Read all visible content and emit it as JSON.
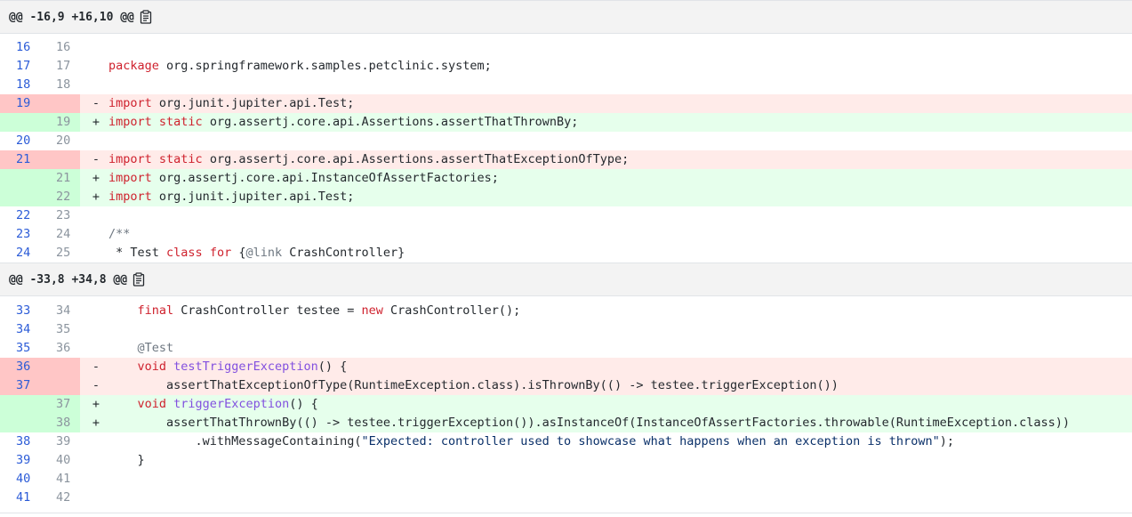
{
  "hunks": [
    {
      "header": "@@ -16,9 +16,10 @@",
      "lines": [
        {
          "type": "context",
          "old": "16",
          "new": "16",
          "sign": "",
          "tokens": []
        },
        {
          "type": "context",
          "old": "17",
          "new": "17",
          "sign": "",
          "tokens": [
            {
              "c": "kw",
              "t": "package"
            },
            {
              "c": "plain",
              "t": " org.springframework.samples.petclinic.system;"
            }
          ]
        },
        {
          "type": "context",
          "old": "18",
          "new": "18",
          "sign": "",
          "tokens": []
        },
        {
          "type": "del",
          "old": "19",
          "new": "",
          "sign": "-",
          "tokens": [
            {
              "c": "kw",
              "t": "import"
            },
            {
              "c": "plain",
              "t": " org.junit.jupiter.api.Test;"
            }
          ]
        },
        {
          "type": "add",
          "old": "",
          "new": "19",
          "sign": "+",
          "tokens": [
            {
              "c": "kw",
              "t": "import"
            },
            {
              "c": "plain",
              "t": " "
            },
            {
              "c": "kw",
              "t": "static"
            },
            {
              "c": "plain",
              "t": " org.assertj.core.api.Assertions.assertThatThrownBy;"
            }
          ]
        },
        {
          "type": "context",
          "old": "20",
          "new": "20",
          "sign": "",
          "tokens": []
        },
        {
          "type": "del",
          "old": "21",
          "new": "",
          "sign": "-",
          "tokens": [
            {
              "c": "kw",
              "t": "import"
            },
            {
              "c": "plain",
              "t": " "
            },
            {
              "c": "kw",
              "t": "static"
            },
            {
              "c": "plain",
              "t": " org.assertj.core.api.Assertions.assertThatExceptionOfType;"
            }
          ]
        },
        {
          "type": "add",
          "old": "",
          "new": "21",
          "sign": "+",
          "tokens": [
            {
              "c": "kw",
              "t": "import"
            },
            {
              "c": "plain",
              "t": " org.assertj.core.api.InstanceOfAssertFactories;"
            }
          ]
        },
        {
          "type": "add",
          "old": "",
          "new": "22",
          "sign": "+",
          "tokens": [
            {
              "c": "kw",
              "t": "import"
            },
            {
              "c": "plain",
              "t": " org.junit.jupiter.api.Test;"
            }
          ]
        },
        {
          "type": "context",
          "old": "22",
          "new": "23",
          "sign": "",
          "tokens": []
        },
        {
          "type": "context",
          "old": "23",
          "new": "24",
          "sign": "",
          "tokens": [
            {
              "c": "cm",
              "t": "/**"
            }
          ]
        },
        {
          "type": "context",
          "old": "24",
          "new": "25",
          "sign": "",
          "tokens": [
            {
              "c": "plain",
              "t": " * Test "
            },
            {
              "c": "kw",
              "t": "class"
            },
            {
              "c": "plain",
              "t": " "
            },
            {
              "c": "kw",
              "t": "for"
            },
            {
              "c": "plain",
              "t": " {"
            },
            {
              "c": "cm",
              "t": "@link"
            },
            {
              "c": "plain",
              "t": " CrashController}"
            }
          ]
        }
      ]
    },
    {
      "header": "@@ -33,8 +34,8 @@",
      "lines": [
        {
          "type": "context",
          "old": "33",
          "new": "34",
          "sign": "",
          "tokens": [
            {
              "c": "plain",
              "t": "    "
            },
            {
              "c": "kw",
              "t": "final"
            },
            {
              "c": "plain",
              "t": " CrashController testee = "
            },
            {
              "c": "kw",
              "t": "new"
            },
            {
              "c": "plain",
              "t": " CrashController();"
            }
          ]
        },
        {
          "type": "context",
          "old": "34",
          "new": "35",
          "sign": "",
          "tokens": []
        },
        {
          "type": "context",
          "old": "35",
          "new": "36",
          "sign": "",
          "tokens": [
            {
              "c": "plain",
              "t": "    "
            },
            {
              "c": "an",
              "t": "@Test"
            }
          ]
        },
        {
          "type": "del",
          "old": "36",
          "new": "",
          "sign": "-",
          "tokens": [
            {
              "c": "plain",
              "t": "    "
            },
            {
              "c": "kw",
              "t": "void"
            },
            {
              "c": "plain",
              "t": " "
            },
            {
              "c": "fn",
              "t": "testTriggerException"
            },
            {
              "c": "plain",
              "t": "() {"
            }
          ]
        },
        {
          "type": "del",
          "old": "37",
          "new": "",
          "sign": "-",
          "tokens": [
            {
              "c": "plain",
              "t": "        assertThatExceptionOfType(RuntimeException.class).isThrownBy(() -> testee.triggerException())"
            }
          ]
        },
        {
          "type": "add",
          "old": "",
          "new": "37",
          "sign": "+",
          "tokens": [
            {
              "c": "plain",
              "t": "    "
            },
            {
              "c": "kw",
              "t": "void"
            },
            {
              "c": "plain",
              "t": " "
            },
            {
              "c": "fn",
              "t": "triggerException"
            },
            {
              "c": "plain",
              "t": "() {"
            }
          ]
        },
        {
          "type": "add",
          "old": "",
          "new": "38",
          "sign": "+",
          "tokens": [
            {
              "c": "plain",
              "t": "        assertThatThrownBy(() -> testee.triggerException()).asInstanceOf(InstanceOfAssertFactories.throwable(RuntimeException.class))"
            }
          ]
        },
        {
          "type": "context",
          "old": "38",
          "new": "39",
          "sign": "",
          "tokens": [
            {
              "c": "plain",
              "t": "            .withMessageContaining("
            },
            {
              "c": "str",
              "t": "\"Expected: controller used to showcase what happens when an exception is thrown\""
            },
            {
              "c": "plain",
              "t": ");"
            }
          ]
        },
        {
          "type": "context",
          "old": "39",
          "new": "40",
          "sign": "",
          "tokens": [
            {
              "c": "plain",
              "t": "    }"
            }
          ]
        },
        {
          "type": "context",
          "old": "40",
          "new": "41",
          "sign": "",
          "tokens": []
        },
        {
          "type": "context",
          "old": "41",
          "new": "42",
          "sign": "",
          "tokens": []
        }
      ]
    }
  ],
  "icons": {
    "copy": "clipboard-icon"
  },
  "colors": {
    "deleted_line": "#ffebe9",
    "deleted_gutter": "#ffc6c6",
    "added_line": "#e6ffec",
    "added_gutter": "#ccffd8",
    "keyword": "#cf222e",
    "function": "#8250df",
    "string": "#0a3069",
    "comment": "#6e7781",
    "line_number": "#2b5bd7"
  }
}
